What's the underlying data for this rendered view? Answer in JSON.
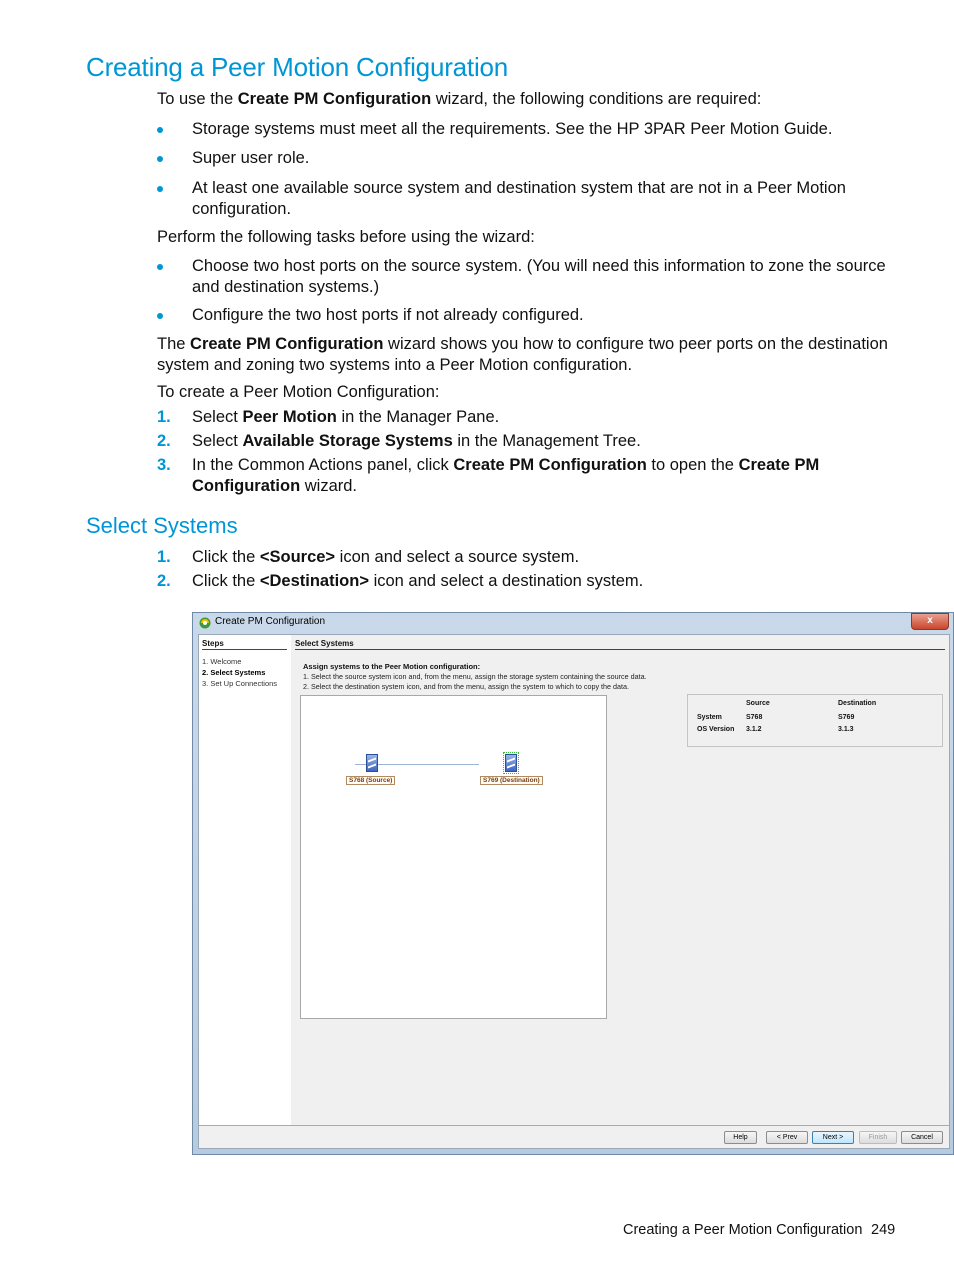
{
  "heading": "Creating a Peer Motion Configuration",
  "intro": {
    "pre": "To use the ",
    "bold": "Create PM Configuration",
    "post": " wizard, the following conditions are required:"
  },
  "requirements": [
    "Storage systems must meet all the requirements. See the HP 3PAR Peer Motion Guide.",
    "Super user role.",
    "At least one available source system and destination system that are not in a Peer Motion configuration."
  ],
  "pre_tasks_intro": "Perform the following tasks before using the wizard:",
  "pre_tasks": [
    "Choose two host ports on the source system. (You will need this information to zone the source and destination systems.)",
    "Configure the two host ports if not already configured."
  ],
  "wizard_desc": {
    "pre": "The ",
    "bold": "Create PM Configuration",
    "post": " wizard shows you how to configure two peer ports on the destination system and zoning two systems into a Peer Motion configuration."
  },
  "create_intro": "To create a Peer Motion Configuration:",
  "steps": [
    {
      "num": "1.",
      "pre": "Select ",
      "bold": "Peer Motion",
      "post": " in the Manager Pane.",
      "bold2": "",
      "post2": ""
    },
    {
      "num": "2.",
      "pre": "Select ",
      "bold": "Available Storage Systems",
      "post": " in the Management Tree.",
      "bold2": "",
      "post2": ""
    },
    {
      "num": "3.",
      "pre": "In the Common Actions panel, click ",
      "bold": "Create PM Configuration",
      "post": " to open the ",
      "bold2": "Create PM Configuration",
      "post2": " wizard."
    }
  ],
  "subheading": "Select Systems",
  "select_steps": [
    {
      "num": "1.",
      "pre": "Click the ",
      "bold": "<Source>",
      "post": " icon and select a source system."
    },
    {
      "num": "2.",
      "pre": "Click the ",
      "bold": "<Destination>",
      "post": " icon and select a destination system."
    }
  ],
  "window": {
    "title": "Create PM Configuration",
    "close_label": "x",
    "steps_header": "Steps",
    "steps": [
      "1. Welcome",
      "2. Select Systems",
      "3. Set Up Connections"
    ],
    "active_step": 1,
    "main_header": "Select Systems",
    "instr_header": "Assign systems to the Peer Motion configuration:",
    "instr": [
      "1. Select the source system icon and, from the menu, assign the storage system containing the source data.",
      "2. Select the destination system icon, and from the menu, assign the system to which to copy the data."
    ],
    "source_label": "S768 (Source)",
    "dest_label": "S769 (Destination)",
    "info": {
      "col_source": "Source",
      "col_dest": "Destination",
      "row_system": "System",
      "row_os": "OS Version",
      "source_system": "S768",
      "dest_system": "S769",
      "source_os": "3.1.2",
      "dest_os": "3.1.3"
    },
    "buttons": {
      "help": "Help",
      "prev": "< Prev",
      "next": "Next >",
      "finish": "Finish",
      "cancel": "Cancel"
    }
  },
  "footer": {
    "title": "Creating a Peer Motion Configuration",
    "page": "249"
  }
}
